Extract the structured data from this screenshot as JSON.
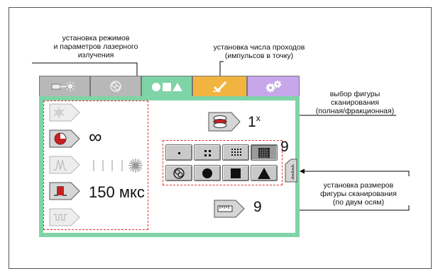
{
  "annotations": {
    "laser_params": [
      "установка режимов",
      "и параметров лазерного",
      "излучения"
    ],
    "passes": [
      "установка числа проходов",
      "(импульсов в точку)"
    ],
    "scan_figure": [
      "выбор фигуры",
      "сканирования",
      "(полная/фракционная)"
    ],
    "scan_size": [
      "установка размеров",
      "фигуры сканирования",
      "(по двум осям)"
    ]
  },
  "tabs": [
    {
      "icon": "laser-icon",
      "color": "#b8b8b8"
    },
    {
      "icon": "scan-pattern-icon",
      "color": "#b8b8b8"
    },
    {
      "icon": "shapes-icon",
      "color": "#7ed4a6",
      "active": true
    },
    {
      "icon": "checkmark-icon",
      "color": "#f2b441"
    },
    {
      "icon": "gears-icon",
      "color": "#c7a6ea"
    }
  ],
  "left_values": {
    "repeat": "∞",
    "duration": "150 мкс"
  },
  "passes": {
    "value": "1",
    "suffix": "x"
  },
  "density_value": "9",
  "size_value": "9"
}
